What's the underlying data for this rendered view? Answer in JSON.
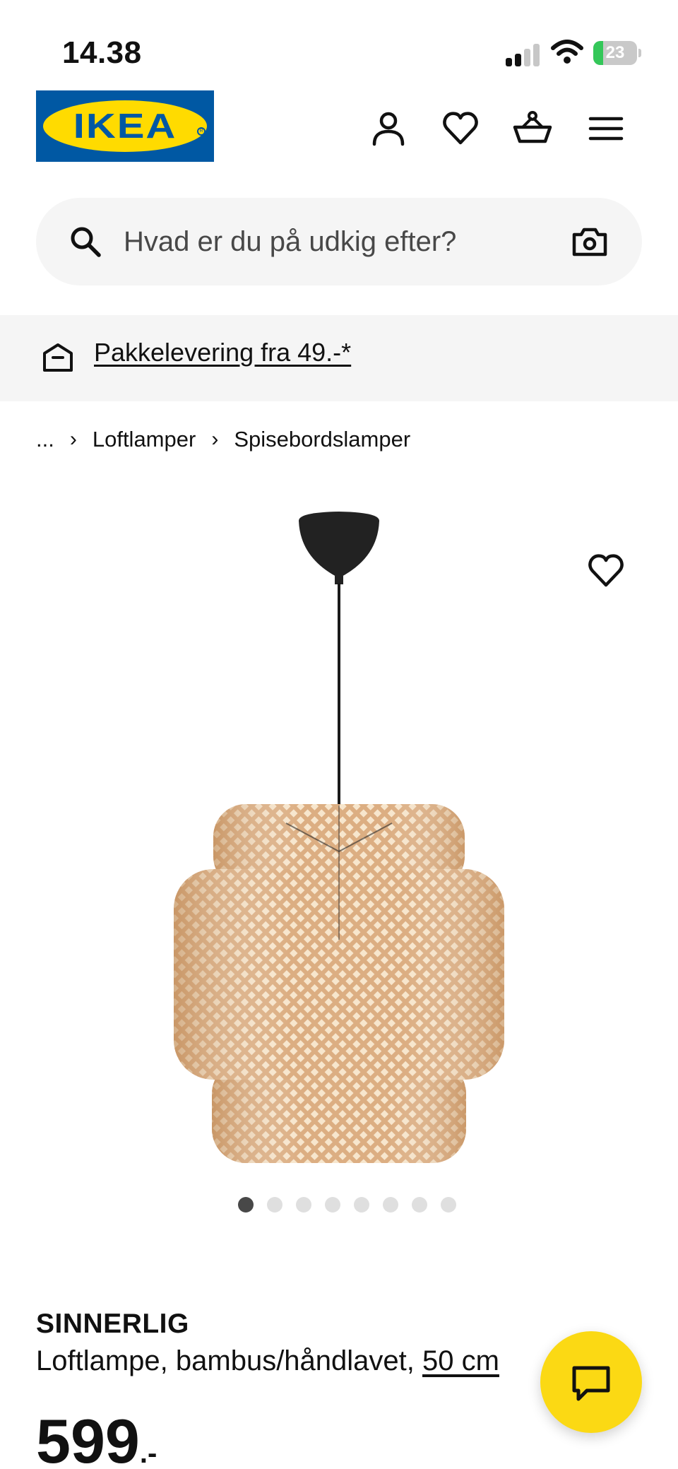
{
  "status_bar": {
    "time": "14.38",
    "battery_level": "23",
    "battery_fraction": 0.23
  },
  "header": {
    "logo_text": "IKEA",
    "icons": [
      "user-icon",
      "heart-icon",
      "basket-icon",
      "menu-icon"
    ]
  },
  "search": {
    "placeholder": "Hvad er du på udkig efter?",
    "value": ""
  },
  "banner": {
    "link_text": "Pakkelevering fra 49.-*"
  },
  "breadcrumb": {
    "ellipsis": "...",
    "items": [
      "Loftlamper",
      "Spisebordslamper"
    ]
  },
  "gallery": {
    "total_images": 8,
    "active_index": 0
  },
  "product": {
    "name": "SINNERLIG",
    "description": "Loftlampe, bambus/håndlavet, ",
    "size": "50 cm",
    "price": "599",
    "price_suffix": ".-"
  },
  "colors": {
    "brand_blue": "#0058a3",
    "brand_yellow": "#ffdb00",
    "chat_yellow": "#fbd914",
    "surface_gray": "#f5f5f5"
  }
}
